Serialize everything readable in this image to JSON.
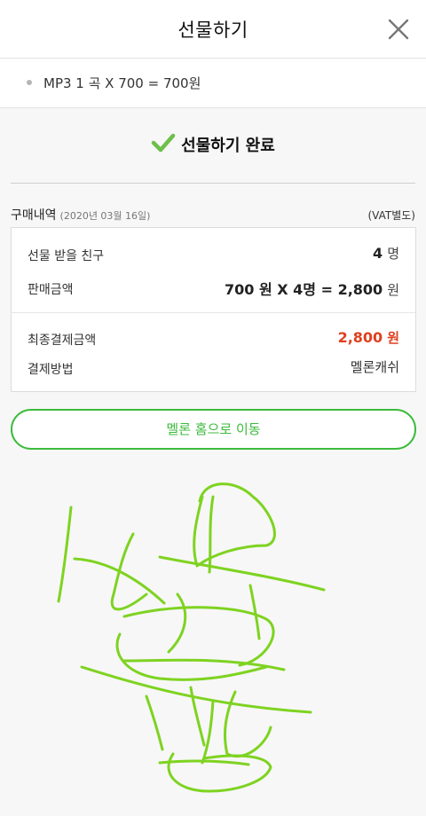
{
  "header": {
    "title": "선물하기",
    "close_icon": "close-icon"
  },
  "item": {
    "text": "MP3 1 곡 X 700 = 700원"
  },
  "status": {
    "icon": "checkmark-icon",
    "text": "선물하기 완료",
    "color": "#6cc04a"
  },
  "purchase": {
    "title": "구매내역",
    "date": "(2020년 03월 16일)",
    "vat": "(VAT별도)",
    "recipients_label": "선물 받을 친구",
    "recipients_value": "4",
    "recipients_unit": "명",
    "price_label": "판매금액",
    "price_value": "700 원 X 4명 = 2,800",
    "price_unit": "원",
    "total_label": "최종결제금액",
    "total_value": "2,800",
    "total_unit": "원",
    "method_label": "결제방법",
    "method_value": "멜론캐쉬"
  },
  "home_button": {
    "label": "멜론 홈으로 이동",
    "color": "#3cbb3c"
  },
  "drawing": {
    "description_icon": "handwritten-scribble",
    "stroke_color": "#7ed321"
  }
}
